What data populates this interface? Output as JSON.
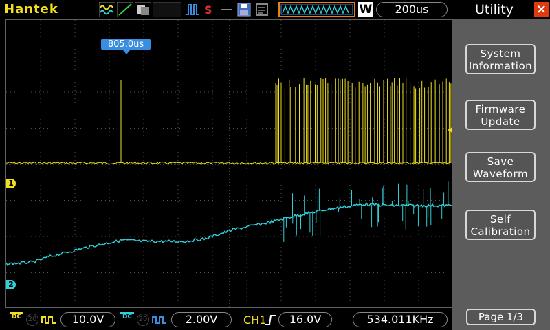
{
  "topbar": {
    "brand": "Hantek",
    "timebase": "200us",
    "window_icon_label": "W",
    "icons": [
      "math-icon",
      "ch1-icon",
      "persist-icon",
      "run-icon",
      "record-icon",
      "save-icon",
      "print-icon",
      "trigger-position-icon"
    ]
  },
  "screen": {
    "time_marker": "805.0us",
    "ch1_marker": "1",
    "ch2_marker": "2",
    "ch1_color": "#f0e020",
    "ch2_color": "#30d0d8"
  },
  "panel": {
    "title": "Utility",
    "buttons": [
      {
        "line1": "System",
        "line2": "Information"
      },
      {
        "line1": "Firmware",
        "line2": "Update"
      },
      {
        "line1": "Save",
        "line2": "Waveform"
      },
      {
        "line1": "Self",
        "line2": "Calibration"
      }
    ],
    "page": "Page 1/3"
  },
  "bottombar": {
    "ch1_coupling": "DC",
    "ch1_volts": "10.0V",
    "ch2_coupling": "DC",
    "ch2_volts": "2.00V",
    "bw_label": "20",
    "trigger_source": "CH1",
    "trigger_level": "16.0V",
    "frequency": "534.011KHz"
  }
}
